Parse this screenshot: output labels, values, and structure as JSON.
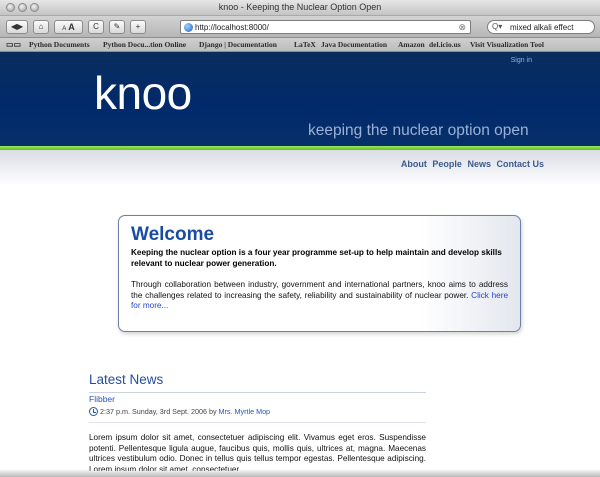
{
  "browser": {
    "window_title": "knoo - Keeping the Nuclear Option Open",
    "toolbar": {
      "back_glyph": "◀",
      "forward_glyph": "▶",
      "home_glyph": "⌂",
      "smaller_text": "A",
      "larger_text": "A",
      "reload_glyph": "C",
      "edit_glyph": "✎",
      "add_glyph": "+"
    },
    "address": {
      "value": "http://localhost:8000/"
    },
    "search": {
      "value": "mixed alkali effect"
    },
    "bookmarks": [
      "Python Documents",
      "Python Docu...tion Online",
      "Django | Documentation",
      "LaTeX",
      "Java Documentation",
      "Amazon",
      "del.icio.us",
      "Visit Visualization Tool"
    ]
  },
  "site": {
    "sign_in": "Sign in",
    "logo": "knoo",
    "tagline": "keeping the nuclear option open",
    "nav": [
      "About",
      "People",
      "News",
      "Contact Us"
    ],
    "welcome": {
      "heading": "Welcome",
      "lead": "Keeping the nuclear option is a four year programme set-up to help maintain and develop skills relevant to nuclear power generation.",
      "body": "Through collaboration between industry, government and international partners, knoo aims to address the challenges related to increasing the safety, reliability and sustainability of nuclear power.",
      "more_link": "Click here for more..."
    },
    "latest_news": {
      "heading": "Latest News",
      "item_title": "Flibber",
      "meta_time": "2:37 p.m. Sunday, 3rd Sept. 2006 by",
      "author": "Mrs. Myrtle Mop",
      "body": "Lorem ipsum dolor sit amet, consectetuer adipiscing elit. Vivamus eget eros. Suspendisse potenti. Pellentesque ligula augue, faucibus quis, mollis quis, ultrices at, magna. Maecenas ultrices vestibulum odio. Donec in tellus quis tellus tempor egestas. Pellentesque adipiscing. Lorem ipsum dolor sit amet, consectetuer"
    }
  },
  "colors": {
    "banner": "#002a6b",
    "accent_green": "#62c31d",
    "heading_blue": "#1a4da1",
    "nav_text": "#3e5a8c"
  }
}
